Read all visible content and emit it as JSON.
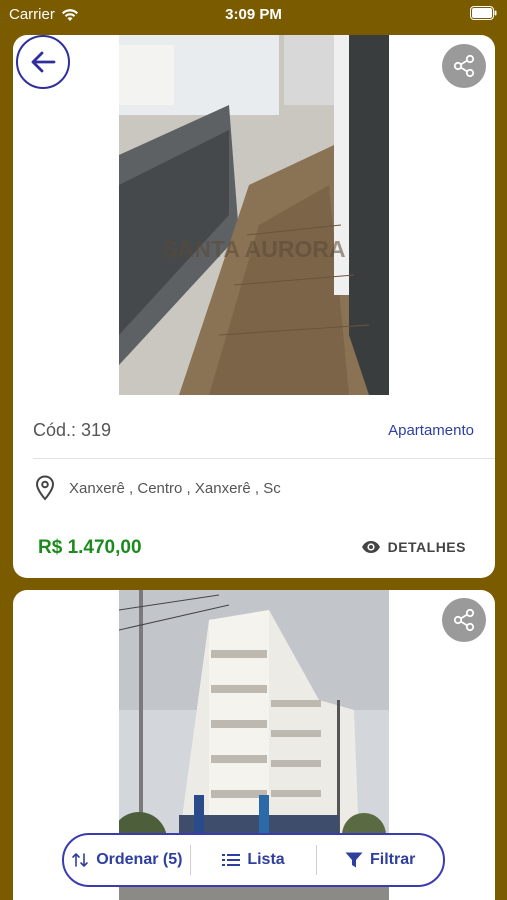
{
  "status_bar": {
    "carrier": "Carrier",
    "time": "3:09 PM"
  },
  "listings": [
    {
      "code": "Cód.: 319",
      "type": "Apartamento",
      "location": "Xanxerê , Centro , Xanxerê , Sc",
      "price": "R$  1.470,00",
      "details_label": "DETALHES",
      "watermark": "SANTA AURORA"
    }
  ],
  "bottom_bar": {
    "sort_label": "Ordenar (5)",
    "list_label": "Lista",
    "filter_label": "Filtrar"
  },
  "colors": {
    "background": "#7a5b00",
    "accent": "#2f3fa0",
    "price": "#1d8a1d"
  },
  "icons": [
    "wifi-icon",
    "battery-icon",
    "back-arrow-icon",
    "share-icon",
    "location-pin-icon",
    "eye-icon",
    "sort-icon",
    "list-icon",
    "filter-icon"
  ]
}
